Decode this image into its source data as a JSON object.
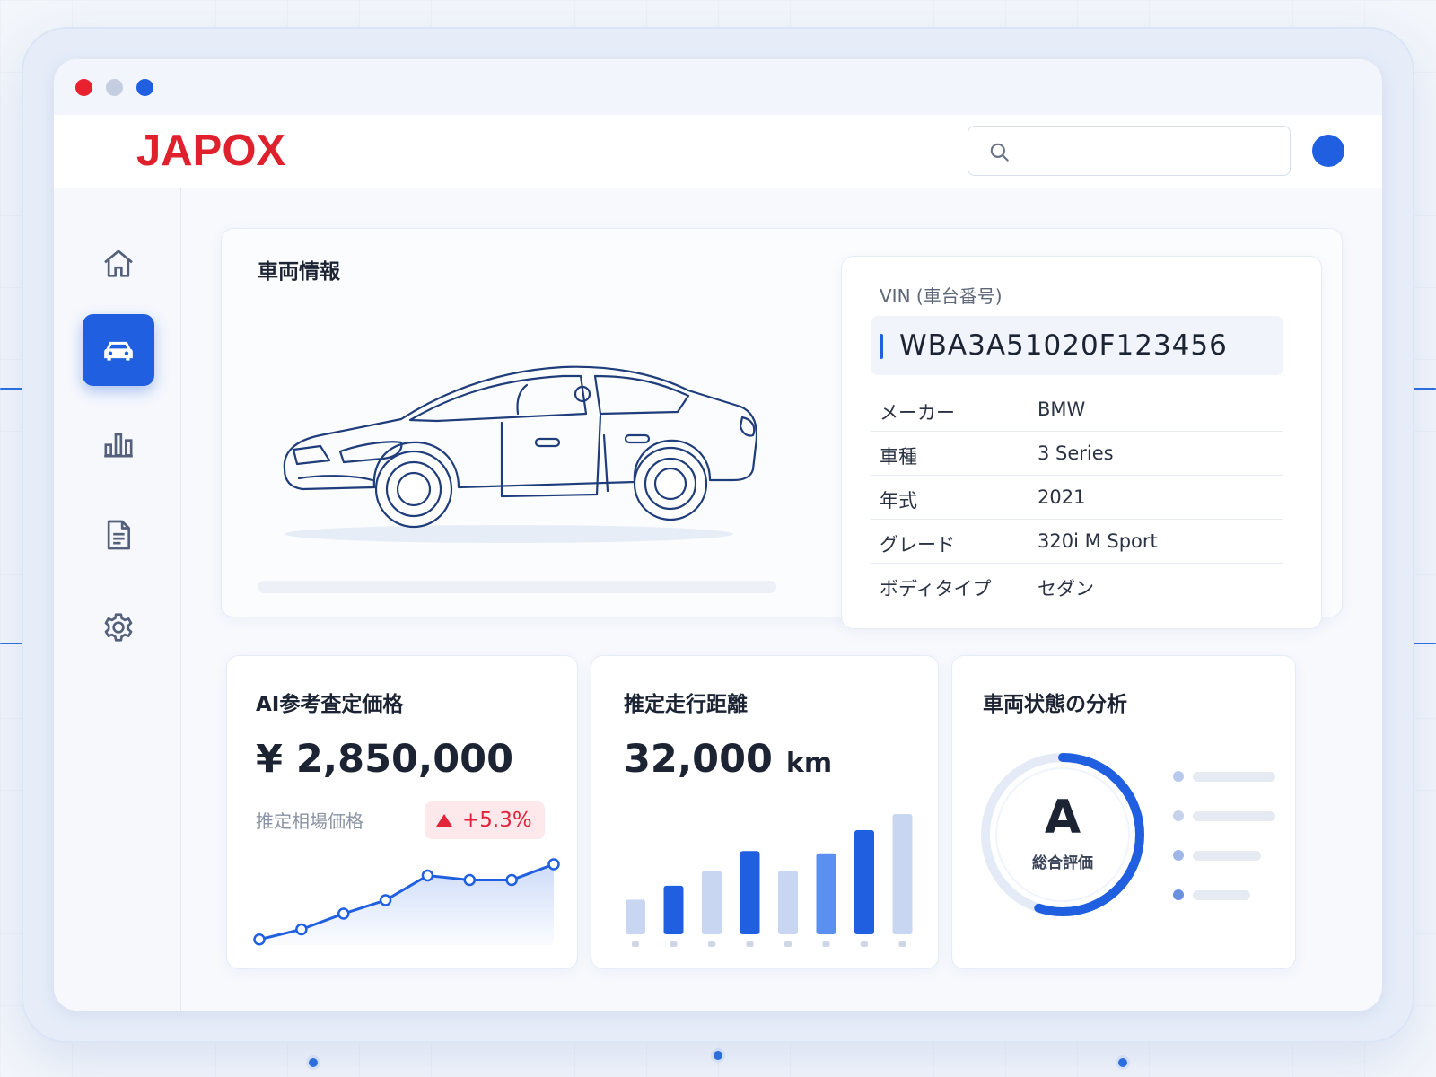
{
  "brand": {
    "name": "JAPOX",
    "color": "#e0212d"
  },
  "accent": "#1f5fe0",
  "search": {
    "placeholder": ""
  },
  "sidebar": {
    "items": [
      {
        "icon": "home-icon",
        "active": false
      },
      {
        "icon": "car-icon",
        "active": true
      },
      {
        "icon": "bar-chart-icon",
        "active": false
      },
      {
        "icon": "document-icon",
        "active": false
      },
      {
        "icon": "gear-icon",
        "active": false
      }
    ]
  },
  "vehicle": {
    "title": "車両情報",
    "vin_label": "VIN (車台番号)",
    "vin": "WBA3A51020F123456",
    "specs": [
      {
        "key": "メーカー",
        "value": "BMW"
      },
      {
        "key": "車種",
        "value": "3 Series"
      },
      {
        "key": "年式",
        "value": "2021"
      },
      {
        "key": "グレード",
        "value": "320i M Sport"
      },
      {
        "key": "ボディタイプ",
        "value": "セダン"
      }
    ]
  },
  "price": {
    "title": "AI参考査定価格",
    "value": "¥ 2,850,000",
    "sub_label": "推定相場価格",
    "change": "+5.3%",
    "trend_points": [
      5,
      14,
      28,
      40,
      62,
      58,
      58,
      72
    ]
  },
  "mileage": {
    "title": "推定走行距離",
    "value": "32,000",
    "unit": "km",
    "bars": [
      {
        "value": 30,
        "emphasis": "light"
      },
      {
        "value": 42,
        "emphasis": "strong"
      },
      {
        "value": 55,
        "emphasis": "light"
      },
      {
        "value": 72,
        "emphasis": "strong"
      },
      {
        "value": 55,
        "emphasis": "light"
      },
      {
        "value": 70,
        "emphasis": "medium"
      },
      {
        "value": 90,
        "emphasis": "strong"
      },
      {
        "value": 104,
        "emphasis": "light"
      }
    ]
  },
  "condition": {
    "title": "車両状態の分析",
    "grade": "A",
    "grade_label": "総合評価",
    "score_fraction": 0.55
  }
}
